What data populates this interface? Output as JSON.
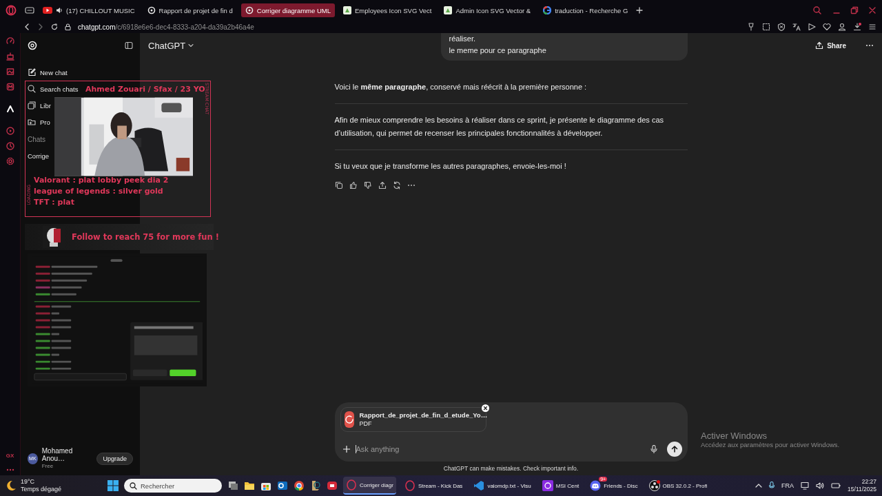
{
  "browser": {
    "tabs": [
      {
        "label": "(17) CHILLOUT MUSIC",
        "kind": "youtube",
        "audio": true,
        "selected": false
      },
      {
        "label": "Rapport de projet de fin d",
        "kind": "openai",
        "audio": false,
        "selected": false
      },
      {
        "label": "Corriger diagramme UML",
        "kind": "openai",
        "audio": false,
        "selected": true
      },
      {
        "label": "Employees Icon SVG Vect",
        "kind": "svgrepo",
        "audio": false,
        "selected": false
      },
      {
        "label": "Admin Icon SVG Vector &",
        "kind": "svgrepo",
        "audio": false,
        "selected": false
      },
      {
        "label": "traduction - Recherche G",
        "kind": "google",
        "audio": false,
        "selected": false
      }
    ],
    "url_host": "chatgpt.com",
    "url_path": "/c/6918e6e6-dec4-8333-a204-da39a2b46a4e"
  },
  "rail": {
    "footer_label": "GX"
  },
  "sidebar": {
    "new_chat": "New chat",
    "items": [
      {
        "label": "Search chats",
        "kind": "search"
      },
      {
        "label": "Libr",
        "kind": "library"
      },
      {
        "label": "Pro",
        "kind": "projects"
      }
    ],
    "section": "Chats",
    "chats": [
      "Corrige"
    ],
    "user": {
      "initials": "MK",
      "name": "Mohamed Anou…",
      "plan": "Free",
      "upgrade": "Upgrade"
    }
  },
  "chat": {
    "model": "ChatGPT",
    "share": "Share",
    "user_message": [
      "réaliser.",
      "le meme pour ce paragraphe"
    ],
    "reply": [
      "Voici le **même paragraphe**, conservé mais réécrit à la première personne :",
      "Afin de mieux comprendre les besoins à réaliser dans ce sprint, je présente le diagramme des cas d’utilisation, qui permet de recenser les principales fonctionnalités à développer.",
      "Si tu veux que je transforme les autres paragraphes, envoie-les-moi !"
    ],
    "attachment": {
      "name": "Rapport_de_projet_de_fin_d_etude_Yo…",
      "type": "PDF"
    },
    "placeholder": "Ask anything",
    "disclaimer": "ChatGPT can make mistakes. Check important info."
  },
  "windows_notice": {
    "title": "Activer Windows",
    "text": "Accédez aux paramètres pour activer Windows."
  },
  "overlay": {
    "title": "Ahmed Zouari / Sfax / 23 YO",
    "ranks": [
      "Valorant : plat lobby peek dia 2",
      "league of legends : silver gold",
      "TFT : plat"
    ],
    "side_labels": [
      "STREAM CHAT",
      "LOADING"
    ],
    "follow": "Follow to reach 75 for more fun !"
  },
  "taskbar": {
    "temperature": "19°C",
    "weather": "Temps dégagé",
    "search_placeholder": "Rechercher",
    "pinned": [
      {
        "kind": "taskview"
      },
      {
        "kind": "explorer"
      },
      {
        "kind": "store"
      },
      {
        "kind": "outlook"
      },
      {
        "kind": "chrome"
      },
      {
        "kind": "lol"
      },
      {
        "kind": "redapp"
      }
    ],
    "apps": [
      {
        "label": "Corriger diagr",
        "kind": "opera",
        "selected": true
      },
      {
        "label": "Stream - Kick Das",
        "kind": "opera",
        "selected": false
      },
      {
        "label": "valomdp.txt - Visu",
        "kind": "vscode",
        "selected": false
      },
      {
        "label": "MSI Cent",
        "kind": "msi",
        "selected": false
      },
      {
        "label": "Friends - Disc",
        "kind": "discord",
        "badge": "9+",
        "selected": false
      },
      {
        "label": "OBS 32.0.2 - Profi",
        "kind": "obs",
        "selected": false
      }
    ],
    "language": "FRA",
    "time": "22:27",
    "date": "15/11/2025"
  }
}
